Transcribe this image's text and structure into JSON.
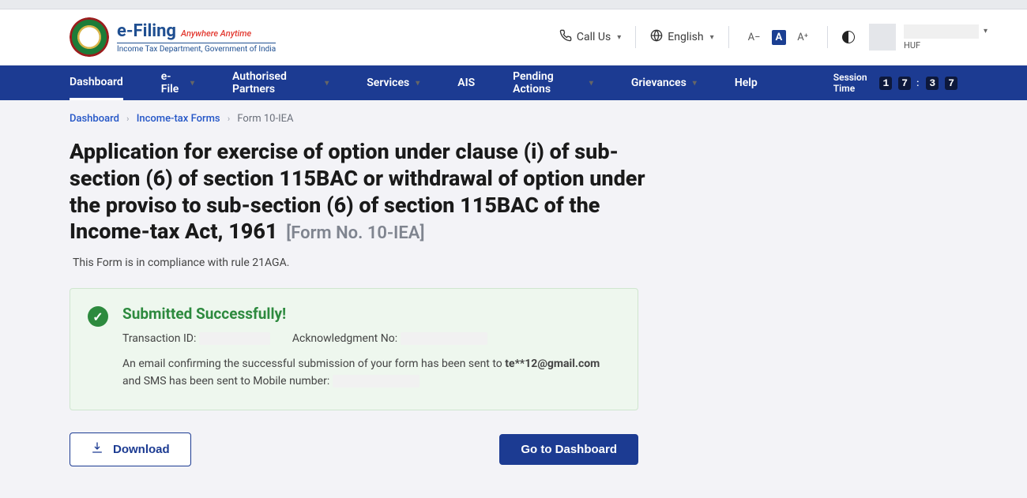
{
  "brand": {
    "main": "e-Filing",
    "tag": "Anywhere Anytime",
    "sub": "Income Tax Department, Government of India"
  },
  "header": {
    "call": "Call Us",
    "lang": "English",
    "font_small": "A−",
    "font_mid": "A",
    "font_big": "A⁺",
    "user_sub": "HUF"
  },
  "nav": {
    "dashboard": "Dashboard",
    "efile": "e-File",
    "authp": "Authorised Partners",
    "services": "Services",
    "ais": "AIS",
    "pending": "Pending Actions",
    "griev": "Grievances",
    "help": "Help",
    "session_label": "Session Time",
    "d1": "1",
    "d2": "7",
    "d3": "3",
    "d4": "7"
  },
  "crumbs": {
    "a": "Dashboard",
    "b": "Income-tax Forms",
    "c": "Form 10-IEA"
  },
  "title_main": "Application for exercise of option under clause (i) of sub-section (6) of section 115BAC or withdrawal of option under the proviso to sub-section (6) of section 115BAC of the Income-tax Act, 1961",
  "title_form": "[Form No. 10-IEA]",
  "subtitle": "This Form is in compliance with rule 21AGA.",
  "success": {
    "title": "Submitted Successfully!",
    "txn_label": "Transaction ID:",
    "ack_label": "Acknowledgment No:",
    "msg_a": "An email confirming the successful submission of your form has been sent to ",
    "email": "te**12@gmail.com",
    "msg_b": " and SMS has been sent to Mobile number: "
  },
  "actions": {
    "download": "Download",
    "goto": "Go to Dashboard"
  }
}
